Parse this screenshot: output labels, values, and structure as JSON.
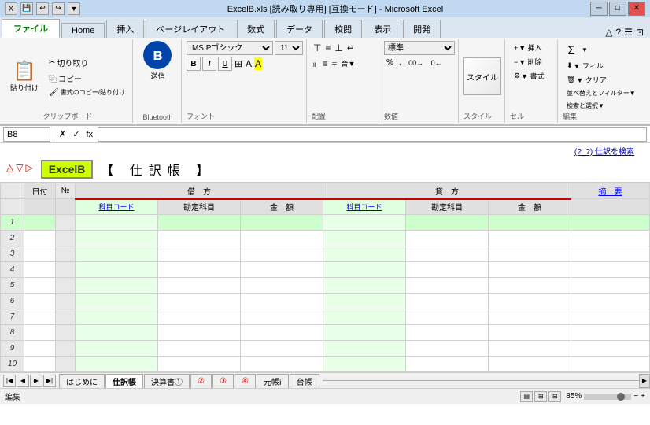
{
  "titlebar": {
    "title": "ExcelB.xls [読み取り専用] [互換モード] - Microsoft Excel",
    "icons": [
      "📄",
      "💾",
      "↩",
      "↪"
    ]
  },
  "tabs": {
    "items": [
      "ファイル",
      "Home",
      "挿入",
      "ページレイアウト",
      "数式",
      "データ",
      "校閲",
      "表示",
      "開発"
    ],
    "active": "ファイル"
  },
  "ribbon": {
    "clipboard_label": "クリップボード",
    "paste_label": "貼り付け",
    "cut_label": "切り取り",
    "copy_label": "コピー",
    "format_painter_label": "書式のコピー/貼り付け",
    "bluetooth_label": "Bluetooth",
    "send_label": "送信",
    "font_name": "MS Pゴシック",
    "font_size": "11",
    "font_label": "フォント",
    "bold": "B",
    "italic": "I",
    "underline": "U",
    "alignment_label": "配置",
    "number_label": "数値",
    "number_format": "標準",
    "style_label": "スタイル",
    "style_btn": "スタイル",
    "cells_label": "セル",
    "insert_label": "▼ 挿入",
    "delete_label": "▼ 削除",
    "format_label": "▼ 書式",
    "edit_label": "編集",
    "sum_label": "Σ",
    "fill_label": "▼ フィル",
    "clear_label": "▼ クリア",
    "sort_filter_label": "並べ替えとフィルター▼",
    "find_select_label": "検索と選択▼"
  },
  "formula_bar": {
    "cell_ref": "B8",
    "cancel_label": "✗",
    "confirm_label": "✓",
    "function_label": "fx",
    "content": ""
  },
  "search_link": "(?_?) 仕訳を検索",
  "sheet": {
    "badge_text": "ExcelB",
    "title": "【 仕訳帳 】",
    "headers": {
      "date": "日付",
      "no": "№",
      "debit_label": "借　方",
      "debit_code": "科目コード",
      "debit_account": "勘定科目",
      "debit_amount": "金　額",
      "credit_label": "貸　方",
      "credit_code": "科目コード",
      "credit_account": "勘定科目",
      "credit_amount": "金　額",
      "summary": "摘　要"
    },
    "rows": [
      {
        "num": 1
      },
      {
        "num": 2
      },
      {
        "num": 3
      },
      {
        "num": 4
      },
      {
        "num": 5
      },
      {
        "num": 6
      },
      {
        "num": 7
      },
      {
        "num": 8
      },
      {
        "num": 9
      },
      {
        "num": 10
      }
    ]
  },
  "sheet_tabs": {
    "items": [
      "はじめに",
      "仕訳帳",
      "決算書①",
      "②",
      "③",
      "④",
      "元帳ⅰ",
      "台帳"
    ],
    "active": "仕訳帳"
  },
  "status_bar": {
    "mode": "編集",
    "zoom": "85%"
  }
}
